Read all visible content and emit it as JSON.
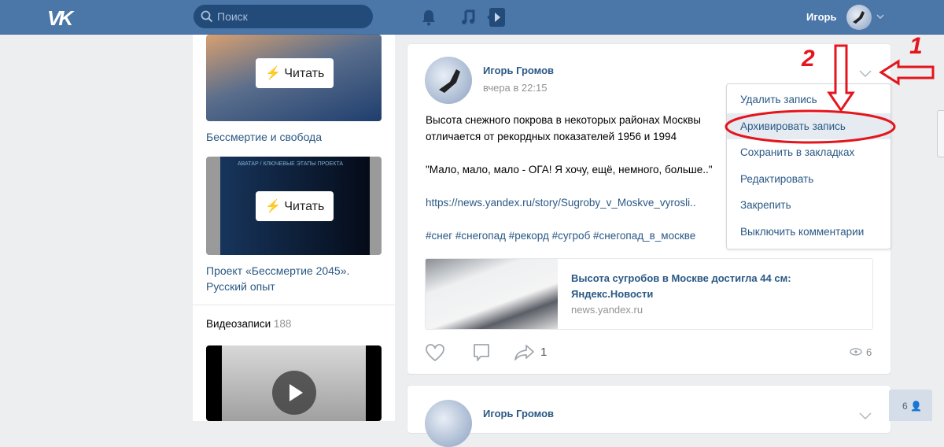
{
  "header": {
    "logo": "VK",
    "search_placeholder": "Поиск",
    "user_name": "Игорь"
  },
  "left": {
    "articles": [
      {
        "read_label": "Читать",
        "title": "Бессмертие и свобода"
      },
      {
        "read_label": "Читать",
        "title": "Проект «Бессмертие 2045». Русский опыт",
        "thumb_heading": "АВАТАР / КЛЮЧЕВЫЕ ЭТАПЫ ПРОЕКТА"
      }
    ],
    "videos_label": "Видеозаписи",
    "videos_count": "188"
  },
  "post": {
    "author": "Игорь Громов",
    "time": "вчера в 22:15",
    "text_1": "Высота снежного покрова в некоторых районах Москвы",
    "text_2": "отличается от рекордных показателей 1956 и 1994",
    "quote": "\"Мало, мало, мало - ОГА! Я хочу, ещё, немного, больше..\"",
    "url": "https://news.yandex.ru/story/Sugroby_v_Moskve_vyrosli..",
    "hashtags": "#снег #снегопад #рекорд #сугроб #снегопад_в_москве",
    "snippet_title": "Высота сугробов в Москве достигла 44 см: Яндекс.Новости",
    "snippet_domain": "news.yandex.ru",
    "shares": "1",
    "views": "6"
  },
  "post2": {
    "author": "Игорь Громов"
  },
  "menu": {
    "items": [
      "Удалить запись",
      "Архивировать запись",
      "Сохранить в закладках",
      "Редактировать",
      "Закрепить",
      "Выключить комментарии"
    ],
    "highlighted": 1
  },
  "friends_online": "6",
  "annotations": {
    "step1": "1",
    "step2": "2",
    "color": "#e4151d"
  }
}
